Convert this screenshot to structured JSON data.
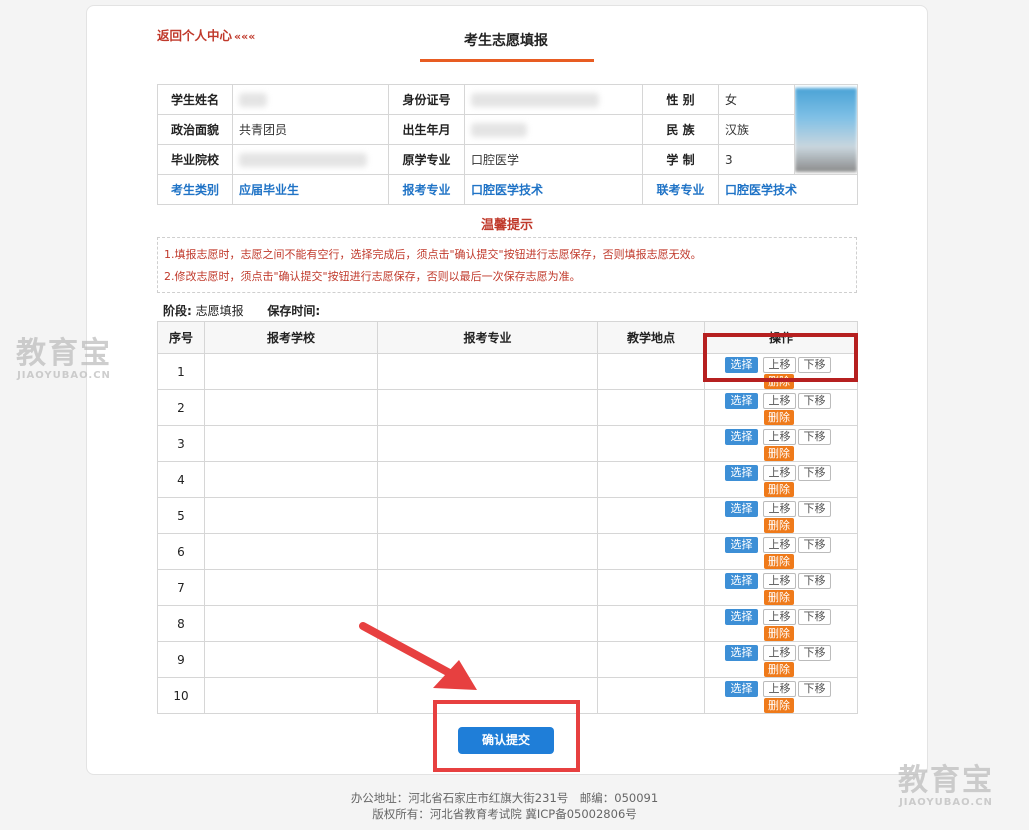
{
  "header": {
    "back_link": "返回个人中心",
    "back_chevron": "«««",
    "title": "考生志愿填报"
  },
  "profile": {
    "labels": {
      "name": "学生姓名",
      "id_number": "身份证号",
      "gender": "性 别",
      "political": "政治面貌",
      "birth": "出生年月",
      "ethnicity": "民 族",
      "school": "毕业院校",
      "original_major": "原学专业",
      "duration": "学 制",
      "category": "考生类别",
      "apply_major": "报考专业",
      "joint_major": "联考专业"
    },
    "values": {
      "gender": "女",
      "political": "共青团员",
      "ethnicity": "汉族",
      "original_major": "口腔医学",
      "duration": "3",
      "category": "应届毕业生",
      "apply_major": "口腔医学技术",
      "joint_major": "口腔医学技术"
    }
  },
  "tips": {
    "title": "温馨提示",
    "line1": "1.填报志愿时，志愿之间不能有空行，选择完成后，须点击\"确认提交\"按钮进行志愿保存，否则填报志愿无效。",
    "line2": "2.修改志愿时，须点击\"确认提交\"按钮进行志愿保存，否则以最后一次保存志愿为准。"
  },
  "stage": {
    "stage_label": "阶段:",
    "stage_value": "志愿填报",
    "save_label": "保存时间:"
  },
  "table": {
    "headers": [
      "序号",
      "报考学校",
      "报考专业",
      "教学地点",
      "操作"
    ],
    "rows": [
      "1",
      "2",
      "3",
      "4",
      "5",
      "6",
      "7",
      "8",
      "9",
      "10"
    ],
    "btn_select": "选择",
    "btn_up": "上移",
    "btn_down": "下移",
    "btn_delete": "删除"
  },
  "submit_label": "确认提交",
  "footer": {
    "line1": "办公地址：河北省石家庄市红旗大街231号　邮编：050091",
    "line2": "版权所有：河北省教育考试院 冀ICP备05002806号"
  },
  "watermark": {
    "cn": "教育宝",
    "en": "JIAOYUBAO.CN"
  },
  "colors": {
    "accent_red": "#c0392b",
    "link_blue": "#1f73c6",
    "button_blue": "#1f7ed8",
    "delete_orange": "#ef7a1a",
    "annotation_red": "#b62020"
  }
}
